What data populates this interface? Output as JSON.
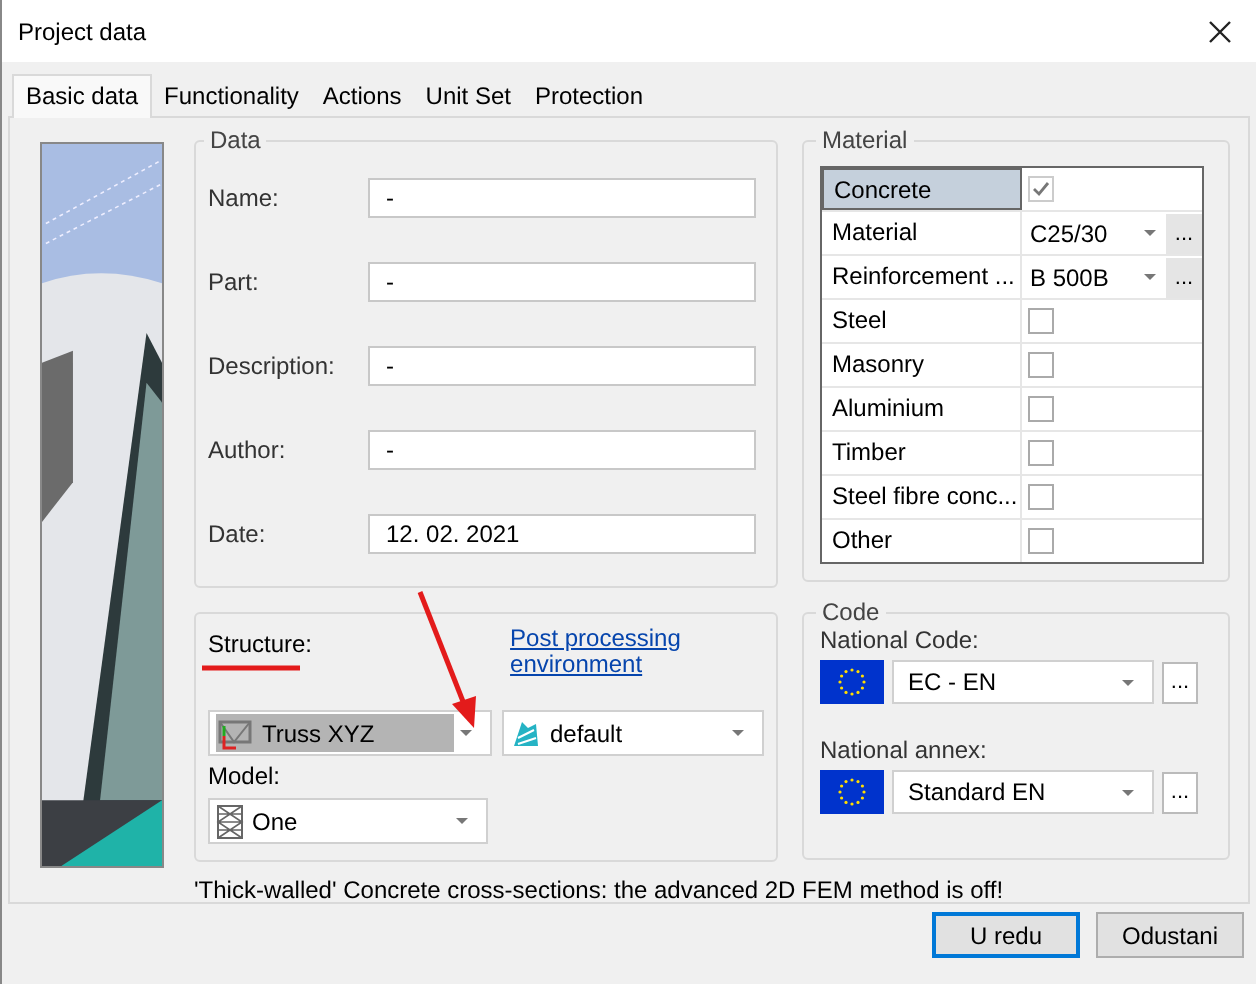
{
  "window": {
    "title": "Project data"
  },
  "tabs": [
    {
      "label": "Basic data",
      "selected": true
    },
    {
      "label": "Functionality",
      "selected": false
    },
    {
      "label": "Actions",
      "selected": false
    },
    {
      "label": "Unit Set",
      "selected": false
    },
    {
      "label": "Protection",
      "selected": false
    }
  ],
  "data": {
    "title": "Data",
    "fields": [
      {
        "label": "Name:",
        "value": "-"
      },
      {
        "label": "Part:",
        "value": "-"
      },
      {
        "label": "Description:",
        "value": "-"
      },
      {
        "label": "Author:",
        "value": "-"
      },
      {
        "label": "Date:",
        "value": "12. 02. 2021"
      }
    ]
  },
  "material": {
    "title": "Material",
    "rows": [
      {
        "kind": "checkbox",
        "label": "Concrete",
        "checked": true,
        "selected": true
      },
      {
        "kind": "dropdown",
        "label": "Material",
        "value": "C25/30",
        "button": "...",
        "selected": false
      },
      {
        "kind": "dropdown",
        "label": "Reinforcement ...",
        "value": "B 500B",
        "button": "...",
        "selected": false
      },
      {
        "kind": "checkbox",
        "label": "Steel",
        "checked": false,
        "selected": false
      },
      {
        "kind": "checkbox",
        "label": "Masonry",
        "checked": false,
        "selected": false
      },
      {
        "kind": "checkbox",
        "label": "Aluminium",
        "checked": false,
        "selected": false
      },
      {
        "kind": "checkbox",
        "label": "Timber",
        "checked": false,
        "selected": false
      },
      {
        "kind": "checkbox",
        "label": "Steel fibre conc...",
        "checked": false,
        "selected": false
      },
      {
        "kind": "checkbox",
        "label": "Other",
        "checked": false,
        "selected": false
      }
    ]
  },
  "structure": {
    "label": "Structure:",
    "value": "Truss XYZ",
    "highlighted": true,
    "link": "Post processing environment",
    "environment": "default",
    "model_label": "Model:",
    "model": "One"
  },
  "code": {
    "title": "Code",
    "rows": [
      {
        "label": "National Code:",
        "value": "EC - EN",
        "button": "..."
      },
      {
        "label": "National annex:",
        "value": "Standard EN",
        "button": "..."
      }
    ]
  },
  "notice": "'Thick-walled' Concrete cross-sections: the advanced 2D FEM method is off!",
  "buttons": [
    {
      "label": "U redu",
      "default": true
    },
    {
      "label": "Odustani",
      "default": false
    }
  ]
}
